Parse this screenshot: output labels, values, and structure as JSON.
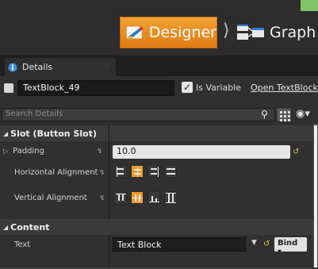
{
  "toolbar": {
    "designer_label": "Designer",
    "graph_label": "Graph",
    "breadcrumb_sep": "⟩"
  },
  "tabs": [
    {
      "label": "Details"
    }
  ],
  "object": {
    "name": "TextBlock_49",
    "is_variable_checked": true,
    "is_variable_label": "Is Variable",
    "open_link": "Open TextBlock"
  },
  "search": {
    "placeholder": "Search Details"
  },
  "categories": {
    "slot": "Slot (Button Slot)",
    "content": "Content"
  },
  "slot": {
    "padding_label": "Padding",
    "padding_value": "10.0",
    "horizontal_label": "Horizontal Alignment",
    "vertical_label": "Vertical Alignment",
    "horizontal_options": [
      "left",
      "center",
      "right",
      "fill"
    ],
    "horizontal_selected": "center",
    "vertical_options": [
      "top",
      "center",
      "bottom",
      "fill"
    ],
    "vertical_selected": "center"
  },
  "content": {
    "text_label": "Text",
    "text_value": "Text Block",
    "bind_label": "Bind"
  },
  "colors": {
    "accent": "#f09a25",
    "panel_bg": "#303030",
    "green_corner": "#7fc46a"
  }
}
